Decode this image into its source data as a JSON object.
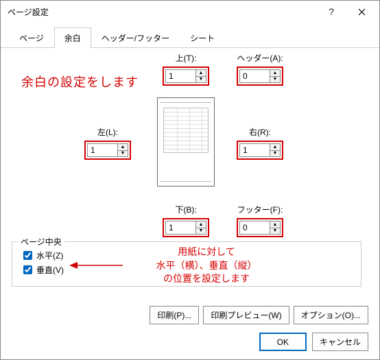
{
  "dialog": {
    "title": "ページ設定"
  },
  "tabs": {
    "page": "ページ",
    "margins": "余白",
    "header_footer": "ヘッダー/フッター",
    "sheet": "シート"
  },
  "annotations": {
    "a1": "余白の設定をします",
    "a2_l1": "用紙に対して",
    "a2_l2": "水平（横）、垂直（縦）",
    "a2_l3": "の位置を設定します"
  },
  "margins": {
    "top_label": "上(T):",
    "top_value": "1",
    "header_label": "ヘッダー(A):",
    "header_value": "0",
    "left_label": "左(L):",
    "left_value": "1",
    "right_label": "右(R):",
    "right_value": "1",
    "bottom_label": "下(B):",
    "bottom_value": "1",
    "footer_label": "フッター(F):",
    "footer_value": "0"
  },
  "center": {
    "group_label": "ページ中央",
    "horiz_label": "水平(Z)",
    "vert_label": "垂直(V)"
  },
  "buttons": {
    "print": "印刷(P)...",
    "preview": "印刷プレビュー(W)",
    "options": "オプション(O)...",
    "ok": "OK",
    "cancel": "キャンセル"
  }
}
